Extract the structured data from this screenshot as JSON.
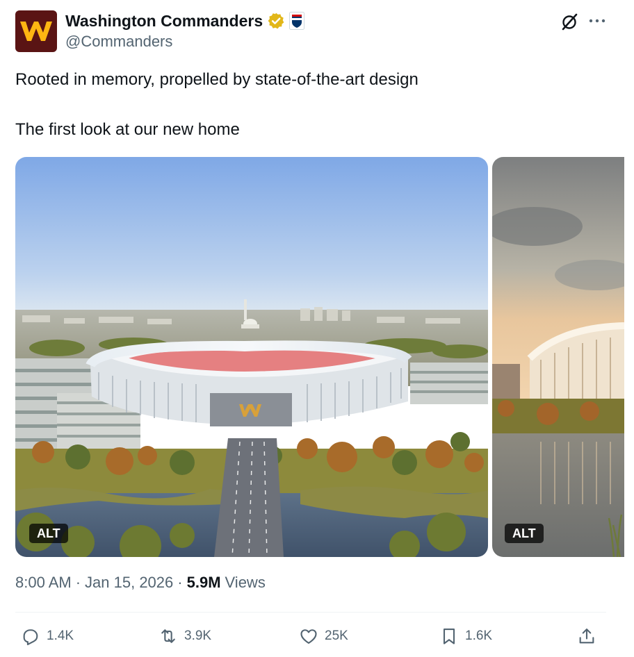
{
  "account": {
    "name": "Washington Commanders",
    "handle": "@Commanders",
    "avatar_letter": "W",
    "verified_badge": "gold-check-badge",
    "affiliate_badge": "nfl-shield-icon"
  },
  "post": {
    "line1": "Rooted in memory, propelled by state-of-the-art design",
    "line2": "The first look at our new home",
    "media": [
      {
        "alt_label": "ALT",
        "stadium_logo": "W"
      },
      {
        "alt_label": "ALT"
      }
    ]
  },
  "meta": {
    "time": "8:00 AM",
    "separator": "·",
    "date": "Jan 15, 2026",
    "views_count": "5.9M",
    "views_label": "Views"
  },
  "actions": {
    "replies": "1.4K",
    "reposts": "3.9K",
    "likes": "25K",
    "bookmarks": "1.6K"
  },
  "colors": {
    "brand_burgundy": "#5a1414",
    "brand_gold": "#ffb612",
    "text_primary": "#0f1419",
    "text_secondary": "#536471",
    "verified_gold": "#e2b719"
  }
}
